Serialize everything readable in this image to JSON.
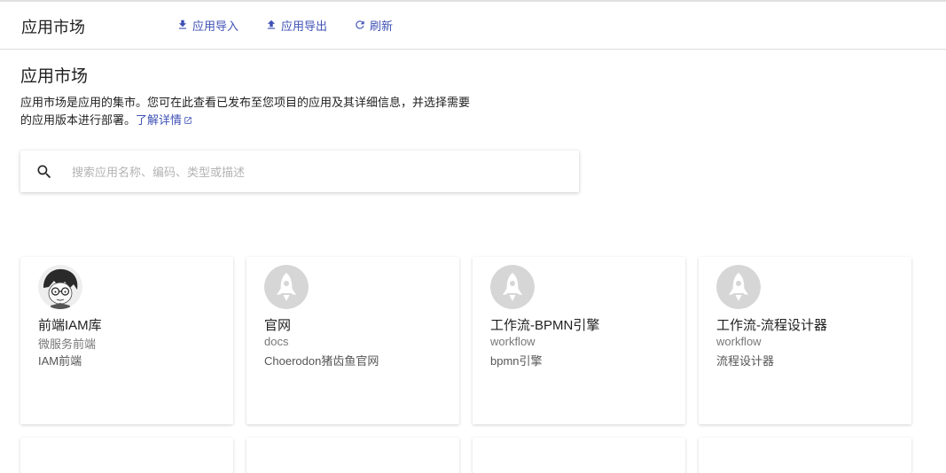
{
  "header": {
    "title": "应用市场",
    "actions": [
      {
        "label": "应用导入",
        "icon": "download-icon"
      },
      {
        "label": "应用导出",
        "icon": "upload-icon"
      },
      {
        "label": "刷新",
        "icon": "refresh-icon"
      }
    ]
  },
  "content": {
    "title": "应用市场",
    "description_line1": "应用市场是应用的集市。您可在此查看已发布至您项目的应用及其详细信息，并选择需要",
    "description_line2": "的应用版本进行部署。",
    "learn_more": "了解详情"
  },
  "search": {
    "placeholder": "搜索应用名称、编码、类型或描述",
    "value": ""
  },
  "apps": [
    {
      "name": "前端IAM库",
      "code": "微服务前端",
      "type": "IAM前端",
      "avatar": "cartoon-avatar"
    },
    {
      "name": "官网",
      "code": "docs",
      "type": "Choerodon猪齿鱼官网",
      "avatar": "rocket-icon"
    },
    {
      "name": "工作流-BPMN引擎",
      "code": "workflow",
      "type": "bpmn引擎",
      "avatar": "rocket-icon"
    },
    {
      "name": "工作流-流程设计器",
      "code": "workflow",
      "type": "流程设计器",
      "avatar": "rocket-icon"
    }
  ],
  "colors": {
    "accent": "#3f51b5",
    "placeholder_avatar": "#d6d6d6"
  }
}
